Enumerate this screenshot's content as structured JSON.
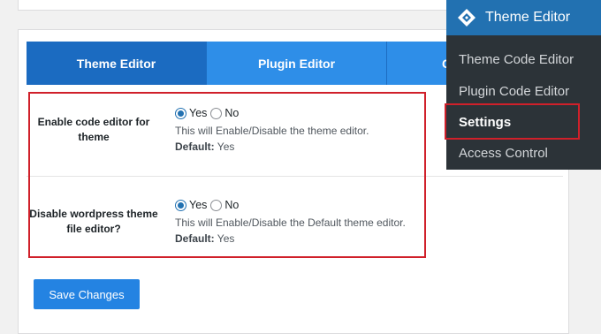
{
  "tabs": [
    {
      "label": "Theme Editor"
    },
    {
      "label": "Plugin Editor"
    },
    {
      "label": "C"
    }
  ],
  "settings": [
    {
      "label": "Enable code editor for theme",
      "options": [
        "Yes",
        "No"
      ],
      "selected": "Yes",
      "description": "This will Enable/Disable the theme editor.",
      "default_label": "Default:",
      "default_value": "Yes"
    },
    {
      "label": "Disable wordpress theme file editor?",
      "options": [
        "Yes",
        "No"
      ],
      "selected": "Yes",
      "description": "This will Enable/Disable the Default theme editor.",
      "default_label": "Default:",
      "default_value": "Yes"
    }
  ],
  "save_button": "Save Changes",
  "menu": {
    "title": "Theme Editor",
    "icon": "theme-editor-logo-icon",
    "items": [
      {
        "label": "Theme Code Editor"
      },
      {
        "label": "Plugin Code Editor"
      },
      {
        "label": "Settings",
        "current": true
      },
      {
        "label": "Access Control"
      }
    ]
  },
  "colors": {
    "tab_active": "#1b6bc1",
    "tab": "#2e8ee8",
    "button": "#2483e2",
    "menu_bg": "#2c3338",
    "menu_header": "#2271b1",
    "highlight": "#d0202a"
  }
}
